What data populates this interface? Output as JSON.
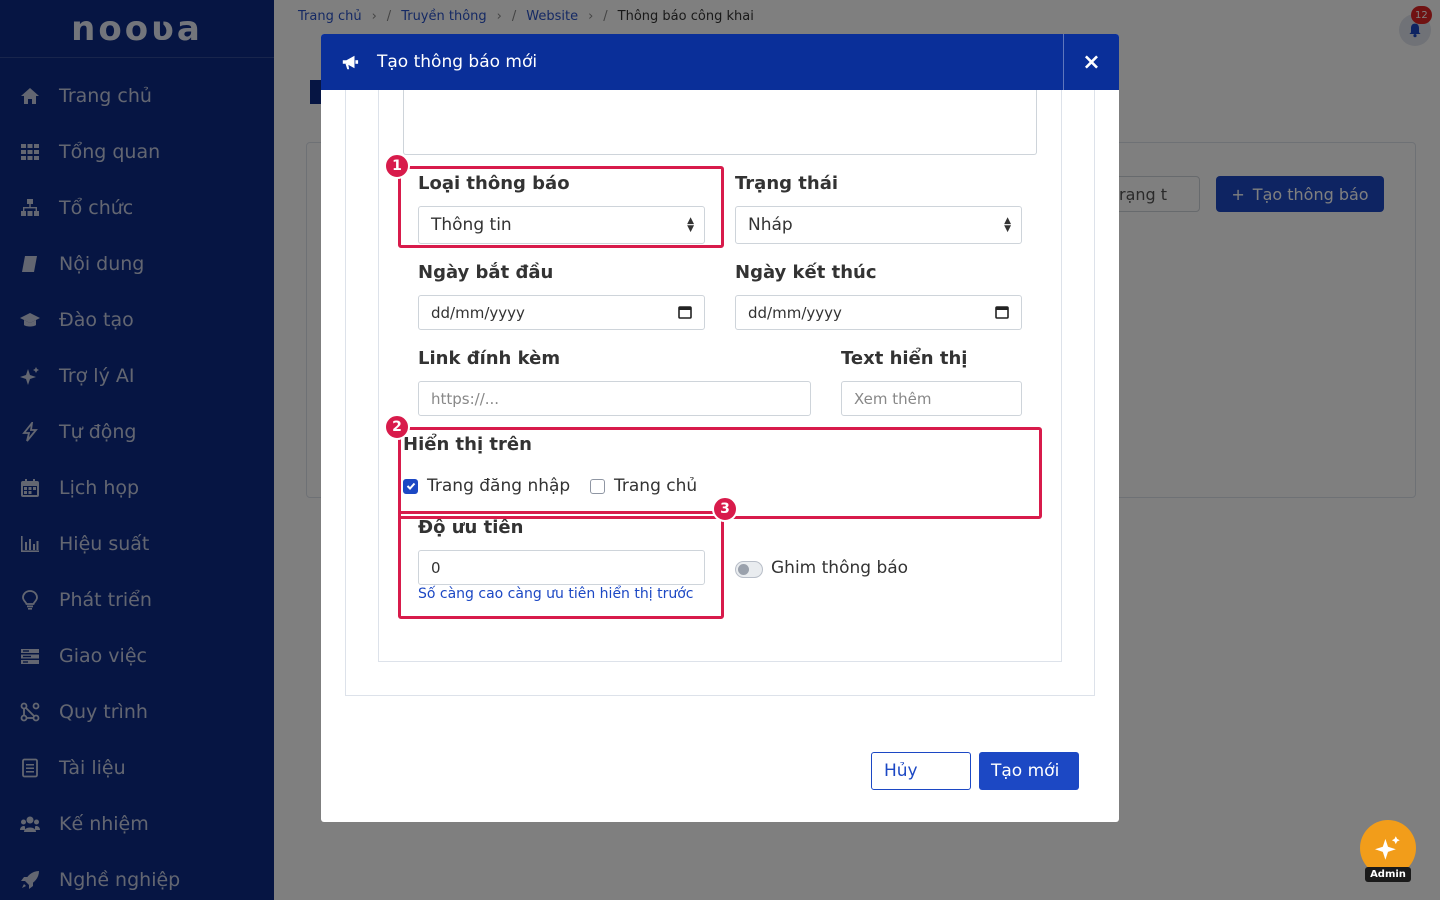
{
  "app": {
    "logo_text": "nooʋa"
  },
  "sidebar": {
    "items": [
      {
        "label": "Trang chủ",
        "icon": "home-icon"
      },
      {
        "label": "Tổng quan",
        "icon": "grid-icon"
      },
      {
        "label": "Tổ chức",
        "icon": "org-chart-icon"
      },
      {
        "label": "Nội dung",
        "icon": "book-icon"
      },
      {
        "label": "Đào tạo",
        "icon": "graduation-cap-icon"
      },
      {
        "label": "Trợ lý AI",
        "icon": "sparkle-icon"
      },
      {
        "label": "Tự động",
        "icon": "bolt-icon"
      },
      {
        "label": "Lịch họp",
        "icon": "calendar-icon"
      },
      {
        "label": "Hiệu suất",
        "icon": "bar-chart-icon"
      },
      {
        "label": "Phát triển",
        "icon": "lightbulb-icon"
      },
      {
        "label": "Giao việc",
        "icon": "tasks-icon"
      },
      {
        "label": "Quy trình",
        "icon": "workflow-icon"
      },
      {
        "label": "Tài liệu",
        "icon": "document-icon"
      },
      {
        "label": "Kế nhiệm",
        "icon": "users-icon"
      },
      {
        "label": "Nghề nghiệp",
        "icon": "rocket-icon"
      }
    ]
  },
  "breadcrumb": {
    "items": [
      "Trang chủ",
      "Truyền thông",
      "Website"
    ],
    "current": "Thông báo công khai"
  },
  "background_page": {
    "status_filter_text": "rạng t",
    "create_button_label": "Tạo thông báo",
    "notification_count": "12"
  },
  "modal": {
    "title": "Tạo thông báo mới",
    "close_label": "×",
    "type_label": "Loại thông báo",
    "type_value": "Thông tin",
    "status_label": "Trạng thái",
    "status_value": "Nháp",
    "start_date_label": "Ngày bắt đầu",
    "start_date_placeholder": "dd/mm/yyyy",
    "end_date_label": "Ngày kết thúc",
    "end_date_placeholder": "dd/mm/yyyy",
    "link_label": "Link đính kèm",
    "link_placeholder": "https://...",
    "display_text_label": "Text hiển thị",
    "display_text_placeholder": "Xem thêm",
    "show_on_label": "Hiển thị trên",
    "show_on_login": {
      "label": "Trang đăng nhập",
      "checked": true
    },
    "show_on_home": {
      "label": "Trang chủ",
      "checked": false
    },
    "priority_label": "Độ ưu tiên",
    "priority_value": "0",
    "priority_help": "Số càng cao càng ưu tiên hiển thị trước",
    "pin_label": "Ghim thông báo",
    "pin_on": false,
    "cancel_label": "Hủy",
    "submit_label": "Tạo mới"
  },
  "annotations": {
    "marker_1": "1",
    "marker_2": "2",
    "marker_3": "3"
  },
  "admin_fab": {
    "label": "Admin"
  },
  "colors": {
    "sidebar_bg": "#0d2b86",
    "modal_header_bg": "#0a2f99",
    "primary": "#1c48c4",
    "highlight": "#d81b4b",
    "fab": "#f29d1a"
  }
}
